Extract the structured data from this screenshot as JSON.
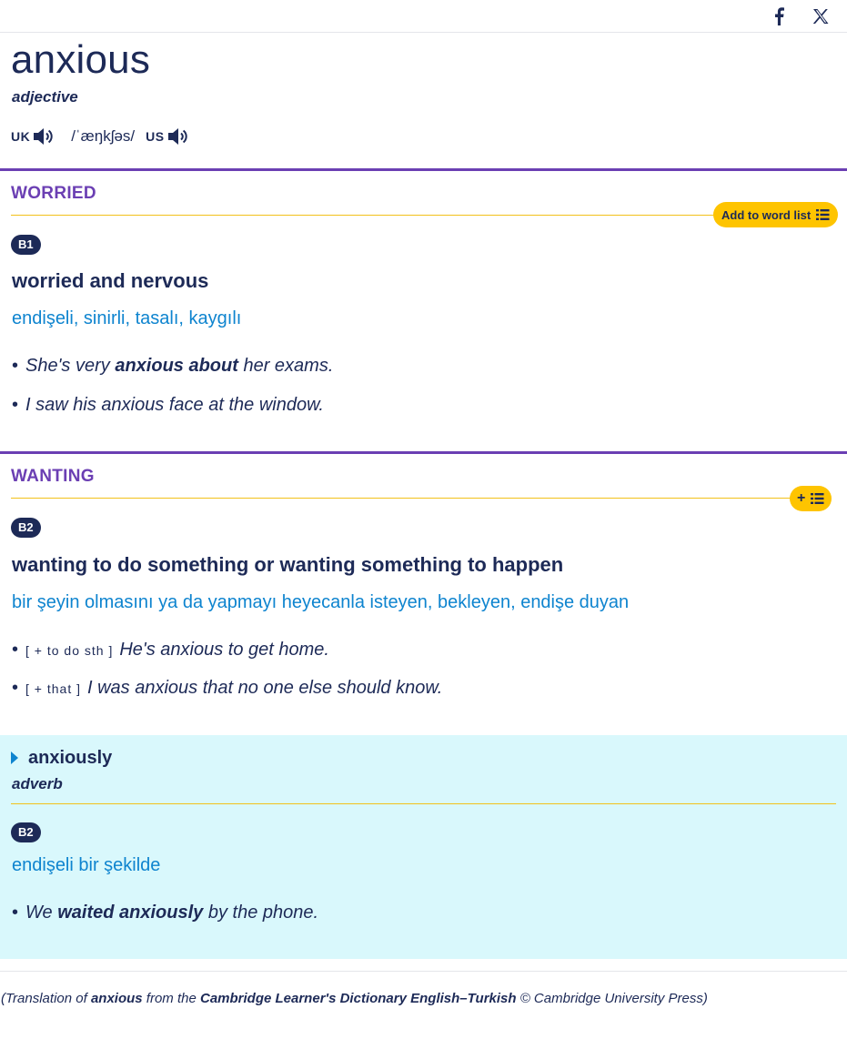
{
  "share": {
    "facebook_icon": "facebook-icon",
    "x_icon": "x-icon"
  },
  "entry": {
    "headword": "anxious",
    "pos": "adjective",
    "pron": {
      "uk_label": "UK",
      "ipa": "/ˈæŋkʃəs/",
      "us_label": "US"
    }
  },
  "senses": [
    {
      "guideword": "WORRIED",
      "wordlist_label": "Add to word list",
      "level": "B1",
      "definition": "worried and nervous",
      "translation": "endişeli, sinirli, tasalı, kaygılı",
      "examples": [
        {
          "pre": "She's very ",
          "bold": "anxious about",
          "post": " her exams."
        },
        {
          "text": "I saw his anxious face at the window."
        }
      ]
    },
    {
      "guideword": "WANTING",
      "wordlist_label": "+",
      "level": "B2",
      "definition": "wanting to do something or wanting something to happen",
      "translation": "bir şeyin olmasını ya da yapmayı heyecanla isteyen, bekleyen, endişe duyan",
      "examples": [
        {
          "gram": "[ + to do sth ]",
          "text": "He's anxious to get home."
        },
        {
          "gram": "[ + that ]",
          "text": "I was anxious that no one else should know."
        }
      ]
    }
  ],
  "runon": {
    "word": "anxiously",
    "pos": "adverb",
    "level": "B2",
    "translation": "endişeli bir şekilde",
    "example": {
      "pre": "We ",
      "bold": "waited anxiously",
      "post": " by the phone."
    }
  },
  "credit": {
    "p1": "(Translation of ",
    "word": "anxious",
    "p2": " from the ",
    "dict": "Cambridge Learner's Dictionary English–Turkish",
    "p3": " © Cambridge University Press)"
  },
  "colors": {
    "navy": "#1d2a57",
    "purple": "#6b3fb3",
    "blue": "#0e84cf",
    "yellow": "#fec400",
    "runon_bg": "#d9f8fc"
  },
  "bullet": "•"
}
